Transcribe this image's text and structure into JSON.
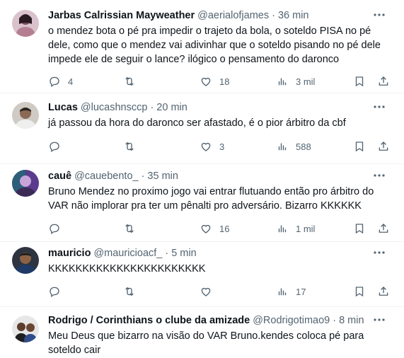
{
  "tweets": [
    {
      "name": "Jarbas Calrissian Mayweather",
      "handle": "@aerialofjames",
      "time": "36 min",
      "text": "o mendez bota o pé pra impedir o trajeto da bola, o soteldo PISA no pé\ndele, como que o mendez vai adivinhar que o soteldo pisando no pé dele\nimpede ele de seguir o lance? ilógico o pensamento do daronco",
      "replies": "4",
      "retweets": "",
      "likes": "18",
      "views": "3 mil"
    },
    {
      "name": "Lucas",
      "handle": "@lucashnsccp",
      "time": "20 min",
      "text": "já passou da hora do daronco ser afastado, é o pior árbitro da cbf",
      "replies": "",
      "retweets": "",
      "likes": "3",
      "views": "588"
    },
    {
      "name": "cauê",
      "handle": "@cauebento_",
      "time": "35 min",
      "text": "Bruno Mendez no proximo jogo vai entrar flutuando então pro árbitro do\nVAR não implorar pra ter um pênalti pro adversário. Bizarro KKKKKK",
      "replies": "",
      "retweets": "",
      "likes": "16",
      "views": "1 mil"
    },
    {
      "name": "mauricio",
      "handle": "@mauricioacf_",
      "time": "5 min",
      "text": "KKKKKKKKKKKKKKKKKKKKKKK",
      "replies": "",
      "retweets": "",
      "likes": "",
      "views": "17"
    },
    {
      "name": "Rodrigo / Corinthians o clube da amizade",
      "handle": "@Rodrigotimao9",
      "time": "8 min",
      "text": "Meu Deus que bizarro na visão do VAR Bruno.kendes coloca pé para\nsoteldo cair",
      "replies": "",
      "retweets": "",
      "likes": "",
      "views": ""
    }
  ],
  "colors": {
    "text": "#0f1419",
    "secondary": "#536471",
    "divider": "#eff3f4"
  },
  "icons": [
    "more-icon",
    "reply-icon",
    "retweet-icon",
    "like-icon",
    "views-icon",
    "bookmark-icon",
    "share-icon"
  ]
}
